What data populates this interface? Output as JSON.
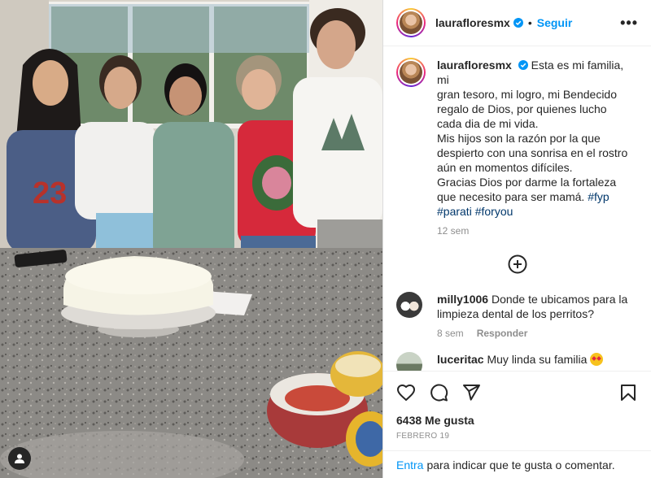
{
  "post": {
    "username": "laurafloresmx",
    "follow_label": "Seguir",
    "more_label": "•••",
    "caption": {
      "lines": [
        "Esta es mi familia, mi",
        "gran tesoro, mi logro, mi Bendecido",
        "regalo de Dios, por quienes lucho",
        "cada dia de mi vida.",
        "Mis hijos son la razón por la que",
        "despierto con una sonrisa en el rostro",
        "aún en momentos difíciles.",
        "Gracias Dios por darme la fortaleza",
        "que necesito para ser mamá."
      ],
      "hashtag_fyp": "#fyp",
      "hashtag_parati": "#parati",
      "hashtag_foryou": "#foryou",
      "time": "12 sem"
    },
    "comments": [
      {
        "username": "milly1006",
        "text_line1": "Donde te ubicamos para la",
        "text_line2": "limpieza dental de los perritos?",
        "time": "8 sem",
        "reply_label": "Responder"
      },
      {
        "username": "luceritac",
        "text": "Muy linda su familia"
      }
    ],
    "likes": "6438 Me gusta",
    "date": "FEBRERO 19",
    "login_link": "Entra",
    "login_text": "para indicar que te gusta o comentar."
  },
  "icons": {
    "verified": "verified-badge-icon",
    "load_more": "plus-circle-icon",
    "like": "heart-icon",
    "comment": "comment-icon",
    "share": "send-icon",
    "save": "bookmark-icon",
    "user_tag": "user-icon"
  },
  "colors": {
    "accent": "#0095f6",
    "hashtag": "#00376b",
    "muted": "#8e8e8e"
  }
}
